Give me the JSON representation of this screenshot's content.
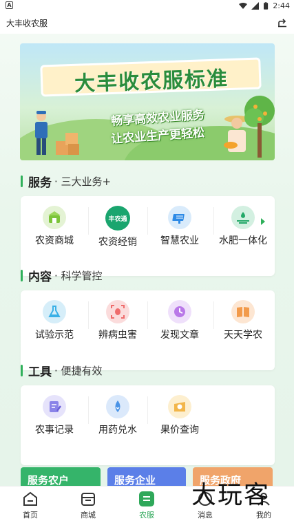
{
  "status_bar": {
    "time": "2:44",
    "left_badge": "A"
  },
  "app_bar": {
    "title": "大丰收农服"
  },
  "banner": {
    "title": "大丰收农服标准",
    "line1": "畅享高效农业服务",
    "line2": "让农业生产更轻松"
  },
  "sections": [
    {
      "title": "服务",
      "subtitle": "· 三大业务+",
      "items": [
        {
          "label": "农资商城",
          "icon": "store-icon",
          "color": "#7cc43a"
        },
        {
          "label": "农资经销",
          "icon": "fengnongtong-icon",
          "color": "#1aa56e",
          "icon_text": "丰农通"
        },
        {
          "label": "智慧农业",
          "icon": "smart-farm-icon",
          "color": "#2d8ae6"
        },
        {
          "label": "水肥一体化",
          "icon": "irrigation-icon",
          "color": "#23a868"
        }
      ]
    },
    {
      "title": "内容",
      "subtitle": "· 科学管控",
      "items": [
        {
          "label": "试验示范",
          "icon": "flask-icon",
          "color": "#3ab0e6"
        },
        {
          "label": "辨病虫害",
          "icon": "bug-scan-icon",
          "color": "#ef6c6c"
        },
        {
          "label": "发现文章",
          "icon": "article-icon",
          "color": "#b978e8"
        },
        {
          "label": "天天学农",
          "icon": "book-icon",
          "color": "#f29a4a"
        }
      ]
    },
    {
      "title": "工具",
      "subtitle": "· 便捷有效",
      "items": [
        {
          "label": "农事记录",
          "icon": "record-icon",
          "color": "#8a83e8"
        },
        {
          "label": "用药兑水",
          "icon": "water-drop-icon",
          "color": "#4a93e6"
        },
        {
          "label": "果价查询",
          "icon": "price-icon",
          "color": "#f2b64a"
        }
      ]
    }
  ],
  "service_tabs": [
    {
      "label": "服务农户",
      "color": "#35b46a"
    },
    {
      "label": "服务企业",
      "color": "#5b7fe8"
    },
    {
      "label": "服务政府",
      "color": "#f0a46a"
    }
  ],
  "bottom_nav": [
    {
      "label": "首页",
      "icon": "home-icon"
    },
    {
      "label": "商城",
      "icon": "mall-icon"
    },
    {
      "label": "农服",
      "icon": "farm-service-icon",
      "active": true
    },
    {
      "label": "消息",
      "icon": "message-icon"
    },
    {
      "label": "我的",
      "icon": "profile-icon"
    }
  ],
  "watermark": "大玩客"
}
